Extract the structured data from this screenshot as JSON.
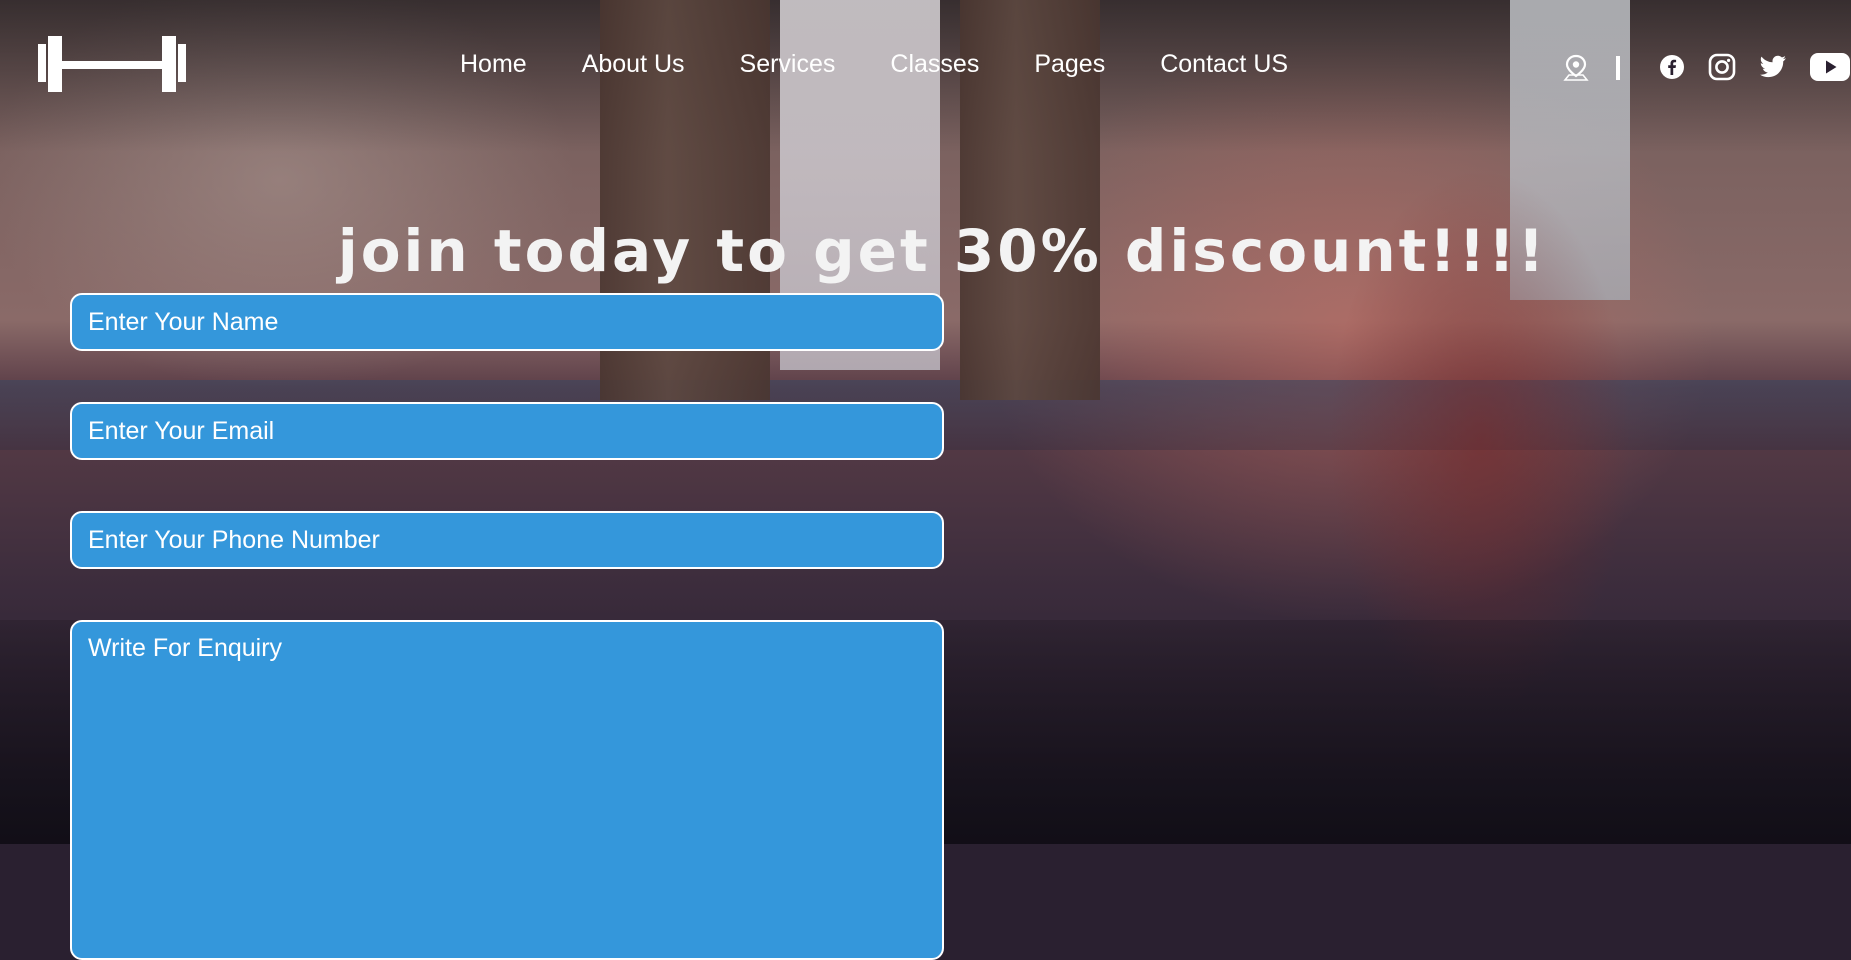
{
  "nav": {
    "items": [
      {
        "label": "Home"
      },
      {
        "label": "About Us"
      },
      {
        "label": "Services"
      },
      {
        "label": "Classes"
      },
      {
        "label": "Pages"
      },
      {
        "label": "Contact US"
      }
    ]
  },
  "header_icons": [
    "location-icon",
    "divider",
    "facebook-icon",
    "instagram-icon",
    "twitter-icon",
    "youtube-icon"
  ],
  "hero": {
    "headline": "join today to get 30% discount!!!!"
  },
  "form": {
    "name_placeholder": "Enter Your Name",
    "email_placeholder": "Enter Your Email",
    "phone_placeholder": "Enter Your Phone Number",
    "enquiry_placeholder": "Write For Enquiry"
  },
  "colors": {
    "field_background": "#3497db",
    "field_border": "#ffffff",
    "text": "#ffffff"
  }
}
